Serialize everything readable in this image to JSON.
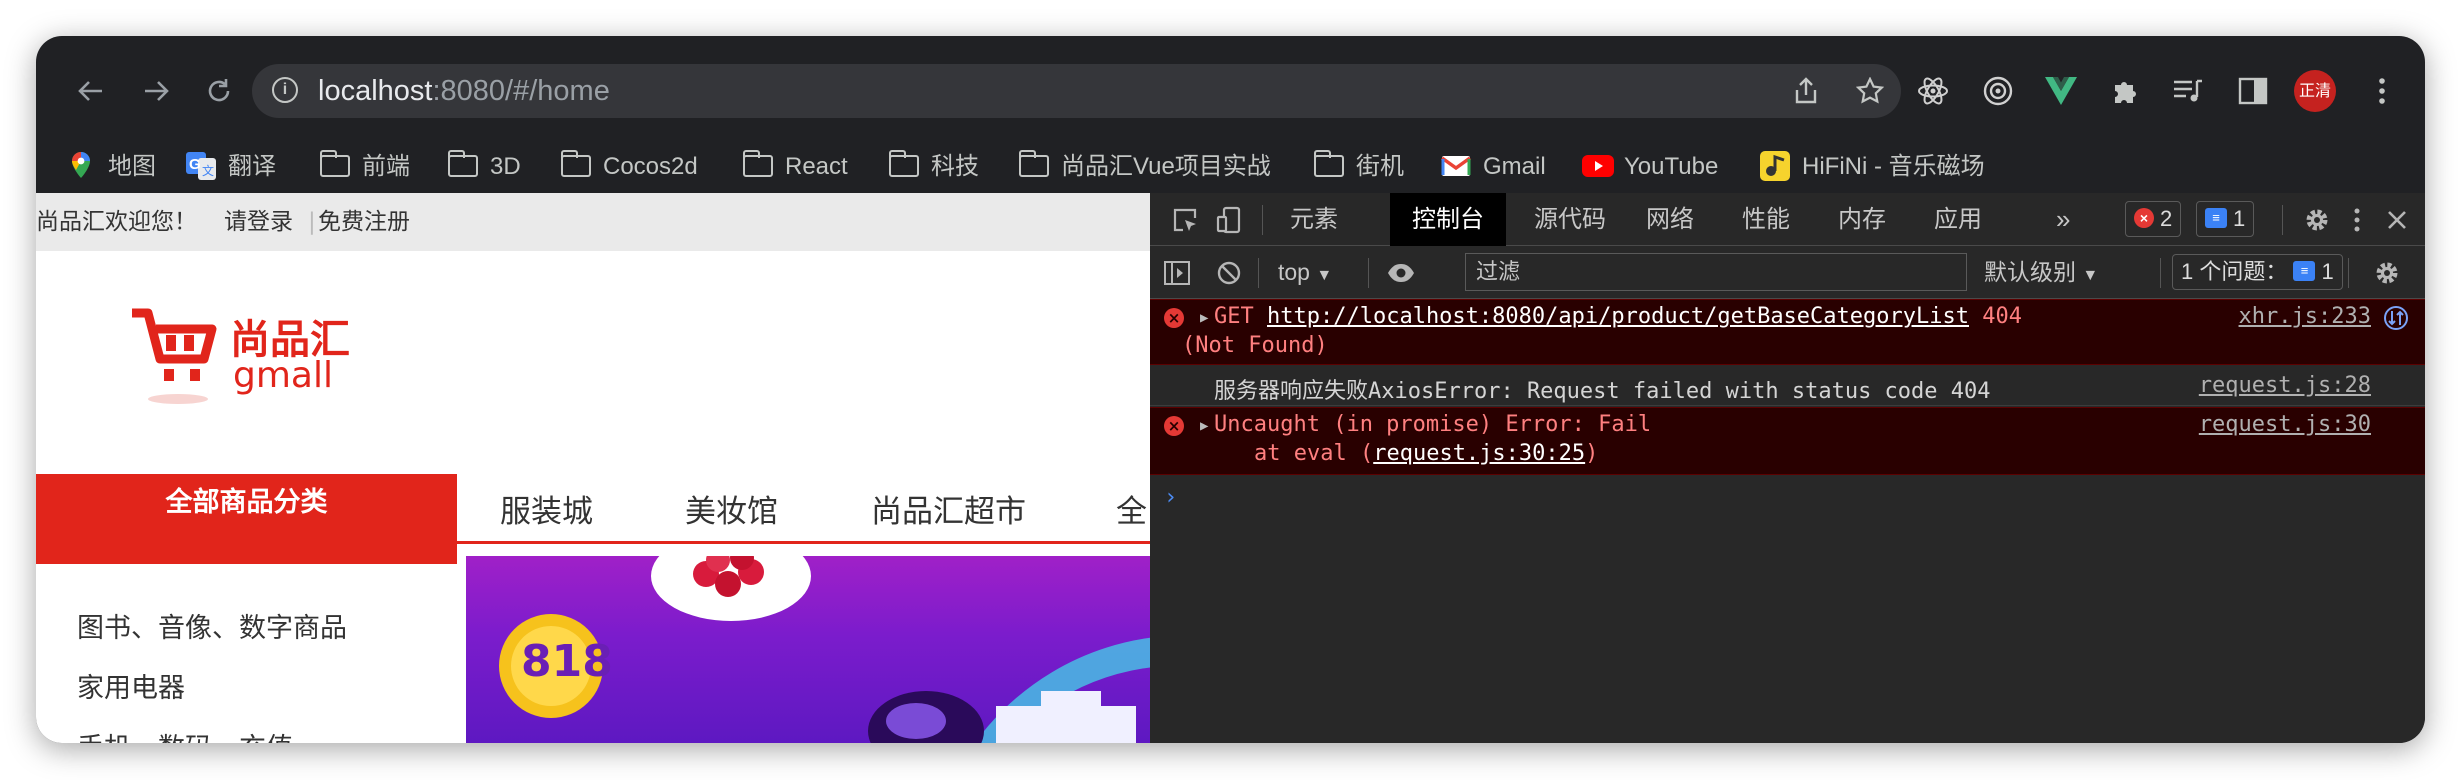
{
  "browser": {
    "url_host": "localhost",
    "url_rest": ":8080/#/home",
    "avatar_text": "正清",
    "bookmarks": [
      {
        "label": "地图",
        "icon": "maps-pin-icon"
      },
      {
        "label": "翻译",
        "icon": "google-translate-icon"
      },
      {
        "label": "前端",
        "icon": "folder-icon"
      },
      {
        "label": "3D",
        "icon": "folder-icon"
      },
      {
        "label": "Cocos2d",
        "icon": "folder-icon"
      },
      {
        "label": "React",
        "icon": "folder-icon"
      },
      {
        "label": "科技",
        "icon": "folder-icon"
      },
      {
        "label": "尚品汇Vue项目实战",
        "icon": "folder-icon"
      },
      {
        "label": "街机",
        "icon": "folder-icon"
      },
      {
        "label": "Gmail",
        "icon": "gmail-icon"
      },
      {
        "label": "YouTube",
        "icon": "youtube-icon"
      },
      {
        "label": "HiFiNi - 音乐磁场",
        "icon": "hifini-icon"
      }
    ]
  },
  "page": {
    "welcome": "尚品汇欢迎您！",
    "login": "请登录",
    "register": "免费注册",
    "logo_name": "尚品汇",
    "logo_sub": "gmall",
    "all_categories": "全部商品分类",
    "nav": [
      "服装城",
      "美妆馆",
      "尚品汇超市",
      "全"
    ],
    "categories": [
      "图书、音像、数字商品",
      "家用电器",
      "手机、数码、充值"
    ]
  },
  "devtools": {
    "tabs": [
      "元素",
      "控制台",
      "源代码",
      "网络",
      "性能",
      "内存",
      "应用"
    ],
    "error_count": "2",
    "message_count": "1",
    "context": "top",
    "filter_placeholder": "过滤",
    "level": "默认级别",
    "issues_label": "1 个问题：",
    "issues_count": "1",
    "console": {
      "row1_method": "GET",
      "row1_url": "http://localhost:8080/api/product/getBaseCategoryList",
      "row1_status": "404",
      "row1_status_text": "(Not Found)",
      "row1_source": "xhr.js:233",
      "row2_text": "服务器响应失败AxiosError: Request failed with status code 404",
      "row2_source": "request.js:28",
      "row3_text": "Uncaught (in promise) Error: Fail",
      "row3_at": "at eval (",
      "row3_link": "request.js:30:25",
      "row3_close": ")",
      "row3_source": "request.js:30"
    }
  },
  "colors": {
    "brand_red": "#e1251b",
    "devtools_bg": "#282828",
    "error_bg": "#290000",
    "error_text": "#ff8080"
  }
}
